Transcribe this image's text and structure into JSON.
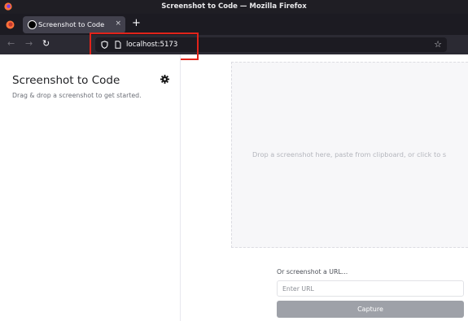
{
  "window": {
    "title": "Screenshot to Code — Mozilla Firefox"
  },
  "tab": {
    "title": "Screenshot to Code",
    "close": "×",
    "new_tab": "+"
  },
  "nav": {
    "back": "←",
    "forward": "→",
    "reload": "↻"
  },
  "urlbar": {
    "url": "localhost:5173",
    "bookmark": "☆"
  },
  "app": {
    "title": "Screenshot to Code",
    "subtitle": "Drag & drop a screenshot to get started."
  },
  "dropzone": {
    "text": "Drop a screenshot here, paste from clipboard, or click to s"
  },
  "url_form": {
    "label": "Or screenshot a URL...",
    "placeholder": "Enter URL",
    "button": "Capture"
  },
  "colors": {
    "highlight": "#e2231a",
    "capture_button": "#9ea1a8"
  }
}
